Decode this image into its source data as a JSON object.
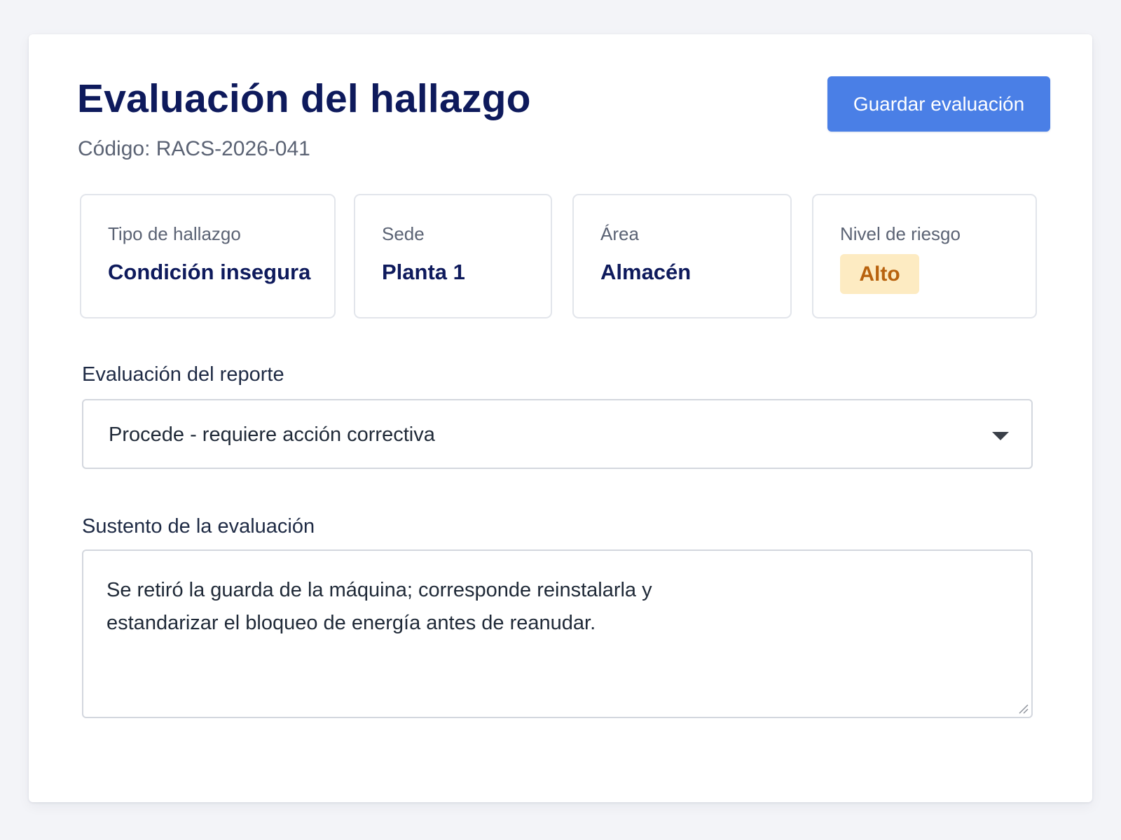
{
  "header": {
    "title": "Evaluación del hallazgo",
    "code": "Código: RACS-2026-041",
    "save_label": "Guardar evaluación"
  },
  "summary": {
    "tipo": {
      "label": "Tipo de hallazgo",
      "value": "Condición insegura"
    },
    "sede": {
      "label": "Sede",
      "value": "Planta 1"
    },
    "area": {
      "label": "Área",
      "value": "Almacén"
    },
    "riesgo": {
      "label": "Nivel de riesgo",
      "value": "Alto"
    }
  },
  "form": {
    "evaluation": {
      "label": "Evaluación del reporte",
      "value": "Procede - requiere acción correctiva"
    },
    "justification": {
      "label": "Sustento de la evaluación",
      "value": "Se retiró la guarda de la máquina; corresponde reinstalarla y estandarizar el bloqueo de energía antes de reanudar."
    }
  },
  "colors": {
    "primary": "#4a7fe6",
    "heading": "#0e1a5c",
    "risk_badge_bg": "#fdebc2",
    "risk_badge_text": "#b8620e"
  },
  "icons": {
    "select_caret": "chevron-down-icon",
    "textarea_resize": "resize-handle-icon"
  }
}
